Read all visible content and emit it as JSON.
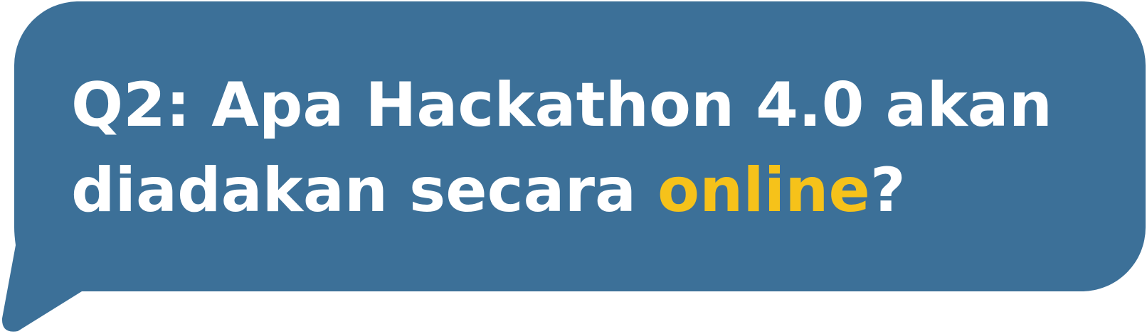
{
  "question": {
    "line1": "Q2: Apa Hackathon 4.0 akan",
    "line2_start": "diadakan secara ",
    "highlight": "online",
    "line2_end": "?"
  },
  "colors": {
    "bubble": "#3c7098",
    "text": "#ffffff",
    "highlight": "#f6c21a"
  }
}
